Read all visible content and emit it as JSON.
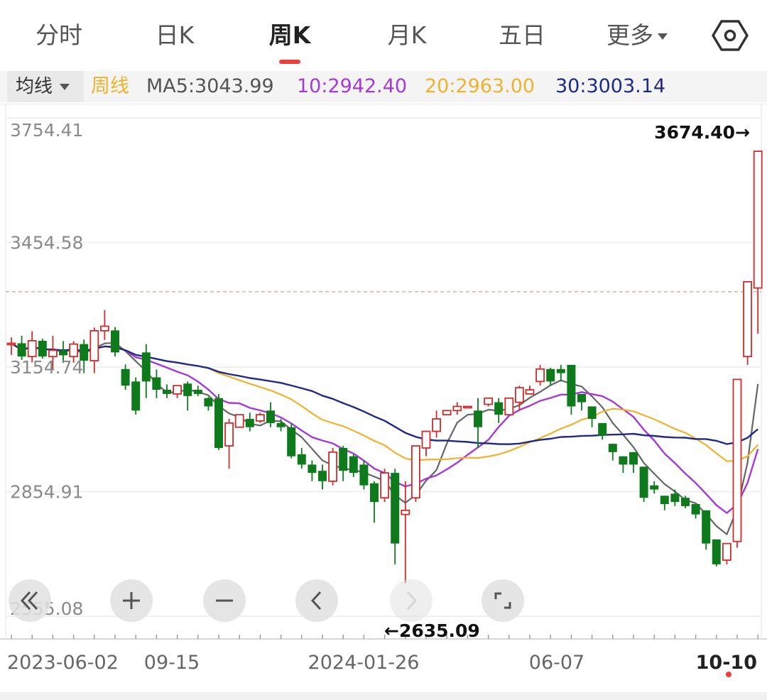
{
  "tabs": [
    {
      "label": "分时"
    },
    {
      "label": "日K"
    },
    {
      "label": "周K",
      "active": true
    },
    {
      "label": "月K"
    },
    {
      "label": "五日"
    },
    {
      "label": "更多"
    }
  ],
  "indicator_bar": {
    "selector_label": "均线",
    "period_label": "周线",
    "ma5": "MA5:3043.99",
    "ma10": "10:2942.40",
    "ma20": "20:2963.00",
    "ma30": "30:3003.14"
  },
  "colors": {
    "up": "#d02c2c",
    "down": "#0e7a1c",
    "ma5": "#666666",
    "ma10": "#a63ad6",
    "ma20": "#efb22f",
    "ma30": "#1f2a86",
    "period_label": "#efb22f",
    "accent": "#e8413c"
  },
  "chart_data": {
    "type": "candlestick",
    "y_axis_labels": [
      "3754.41",
      "3454.58",
      "3154.74",
      "2854.91",
      "2555.08"
    ],
    "x_axis_labels": [
      "2023-06-02",
      "09-15",
      "2024-01-26",
      "06-07",
      "10-10"
    ],
    "ylim": [
      2555.08,
      3754.41
    ],
    "max_marker": "3674.40→",
    "min_marker": "←2635.09",
    "reference_line": 3336,
    "candles": [
      [
        3210,
        3226,
        3212,
        3184
      ],
      [
        3212,
        3230,
        3180,
        3172
      ],
      [
        3180,
        3241,
        3218,
        3166
      ],
      [
        3218,
        3223,
        3180,
        3175
      ],
      [
        3180,
        3230,
        3195,
        3150
      ],
      [
        3195,
        3217,
        3183,
        3165
      ],
      [
        3180,
        3217,
        3210,
        3165
      ],
      [
        3210,
        3221,
        3170,
        3140
      ],
      [
        3170,
        3250,
        3242,
        3140
      ],
      [
        3242,
        3292,
        3253,
        3220
      ],
      [
        3243,
        3251,
        3190,
        3180
      ],
      [
        3150,
        3161,
        3110,
        3100
      ],
      [
        3120,
        3130,
        3050,
        3040
      ],
      [
        3190,
        3210,
        3120,
        3080
      ],
      [
        3130,
        3149,
        3100,
        3080
      ],
      [
        3100,
        3113,
        3090,
        3080
      ],
      [
        3090,
        3110,
        3110,
        3080
      ],
      [
        3115,
        3120,
        3085,
        3050
      ],
      [
        3100,
        3110,
        3090,
        3085
      ],
      [
        3080,
        3083,
        3060,
        3050
      ],
      [
        3080,
        3090,
        2960,
        2955
      ],
      [
        2965,
        3030,
        3020,
        2910
      ],
      [
        3010,
        3040,
        3040,
        3020
      ],
      [
        3030,
        3045,
        3010,
        3000
      ],
      [
        3025,
        3045,
        3040,
        3020
      ],
      [
        3050,
        3070,
        3020,
        3010
      ],
      [
        3020,
        3030,
        3010,
        3000
      ],
      [
        3010,
        3020,
        2940,
        2935
      ],
      [
        2945,
        2960,
        2920,
        2910
      ],
      [
        2920,
        2930,
        2900,
        2880
      ],
      [
        2905,
        2920,
        2880,
        2860
      ],
      [
        2880,
        2960,
        2950,
        2870
      ],
      [
        2960,
        2965,
        2905,
        2880
      ],
      [
        2940,
        2945,
        2900,
        2890
      ],
      [
        2920,
        2930,
        2870,
        2860
      ],
      [
        2875,
        2880,
        2830,
        2780
      ],
      [
        2840,
        2910,
        2900,
        2830
      ],
      [
        2900,
        2910,
        2730,
        2680
      ],
      [
        2800,
        2880,
        2810,
        2635
      ],
      [
        2840,
        2960,
        2965,
        2830
      ],
      [
        2960,
        3000,
        3000,
        2940
      ],
      [
        3000,
        3050,
        3030,
        2985
      ],
      [
        3040,
        3050,
        3050,
        3040
      ],
      [
        3050,
        3070,
        3060,
        3040
      ],
      [
        3060,
        3060,
        3060,
        3060
      ],
      [
        3050,
        3080,
        3010,
        2960
      ],
      [
        3065,
        3080,
        3080,
        3060
      ],
      [
        3070,
        3080,
        3040,
        3020
      ],
      [
        3040,
        3080,
        3080,
        3040
      ],
      [
        3070,
        3110,
        3105,
        3050
      ],
      [
        3090,
        3110,
        3100,
        3090
      ],
      [
        3120,
        3160,
        3150,
        3110
      ],
      [
        3150,
        3153,
        3120,
        3110
      ],
      [
        3150,
        3160,
        3140,
        3120
      ],
      [
        3160,
        3150,
        3060,
        3040
      ],
      [
        3090,
        3070,
        3070,
        3050
      ],
      [
        3060,
        3045,
        3030,
        3010
      ],
      [
        3020,
        3010,
        2990,
        2980
      ],
      [
        2970,
        2960,
        2950,
        2930
      ],
      [
        2940,
        2930,
        2920,
        2900
      ],
      [
        2950,
        2940,
        2920,
        2900
      ],
      [
        2915,
        2910,
        2840,
        2830
      ],
      [
        2870,
        2880,
        2860,
        2850
      ],
      [
        2845,
        2840,
        2825,
        2810
      ],
      [
        2850,
        2860,
        2830,
        2820
      ],
      [
        2840,
        2845,
        2820,
        2815
      ],
      [
        2825,
        2820,
        2800,
        2790
      ],
      [
        2810,
        2800,
        2730,
        2715
      ],
      [
        2740,
        2720,
        2680,
        2675
      ],
      [
        2690,
        2720,
        2730,
        2680
      ],
      [
        2735,
        3100,
        3125,
        2720
      ],
      [
        3180,
        3360,
        3360,
        3160
      ],
      [
        3345,
        3674,
        3674,
        3235
      ]
    ],
    "series": [
      {
        "name": "MA5"
      },
      {
        "name": "10"
      },
      {
        "name": "20"
      },
      {
        "name": "30"
      }
    ]
  },
  "controls": [
    {
      "name": "fast-back"
    },
    {
      "name": "zoom-in"
    },
    {
      "name": "zoom-out"
    },
    {
      "name": "step-back"
    },
    {
      "name": "step-forward"
    },
    {
      "name": "fullscreen"
    }
  ]
}
